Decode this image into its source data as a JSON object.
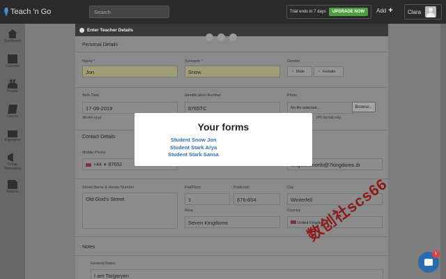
{
  "app": {
    "name": "Teach 'n Go"
  },
  "search": {
    "placeholder": "Search"
  },
  "trial": {
    "text": "Trial ends in 7 days",
    "upgrade_label": "UPGRADE NOW"
  },
  "topbar": {
    "add_label": "Add",
    "user_name": "Clara"
  },
  "sidebar": {
    "items": [
      {
        "label": "Dashboard",
        "icon": "home-icon"
      },
      {
        "label": "Calendar",
        "icon": "calendar-icon"
      },
      {
        "label": "People",
        "icon": "people-icon"
      },
      {
        "label": "Classes",
        "icon": "classes-icon"
      },
      {
        "label": "Payments",
        "icon": "payments-icon"
      },
      {
        "label": "Group Messaging",
        "icon": "megaphone-icon"
      },
      {
        "label": "Reports",
        "icon": "reports-icon"
      }
    ]
  },
  "modal": {
    "title": "Enter Teacher Details"
  },
  "personal": {
    "section_title": "Personal Details",
    "name_label": "Name *",
    "name_value": "Jon",
    "surname_label": "Surname *",
    "surname_value": "Snow",
    "gender_label": "Gender",
    "male_label": "Male",
    "female_label": "Female",
    "birth_label": "Birth Date",
    "birth_value": "17-09-2019",
    "birth_hint": "dd-mm-yyyy",
    "id_label": "Identification Number",
    "id_value": "8765TC",
    "photo_label": "Photo",
    "photo_value": "No file selected...",
    "photo_browse": "Browse...",
    "photo_hint": "JPG format only"
  },
  "contact": {
    "section_title": "Contact Details",
    "mobile_label": "Mobile Phone",
    "mobile_prefix": "+44",
    "mobile_value": "87652",
    "email_value": "kingofthenorth@7kingdoms.dr",
    "street_label": "Street Name & House Number",
    "street_value": "Old God's Street",
    "flat_label": "Flat/Floor",
    "flat_value": "1",
    "postcode_label": "Postcode",
    "postcode_value": "676-654",
    "city_label": "City",
    "city_value": "Winterfell",
    "area_label": "Area",
    "area_value": "Seven Kingdoms",
    "country_label": "Country",
    "country_value": "United Kingdom"
  },
  "notes": {
    "section_title": "Notes",
    "general_label": "General Notes",
    "general_value": "I am Targaryen"
  },
  "overlay": {
    "title": "Your forms",
    "links": [
      "Student Snow Jon",
      "Student Stark Arya",
      "Student Stark Sansa"
    ]
  },
  "watermark": {
    "text": "数创社scs66"
  },
  "chat": {
    "badge": "1"
  }
}
